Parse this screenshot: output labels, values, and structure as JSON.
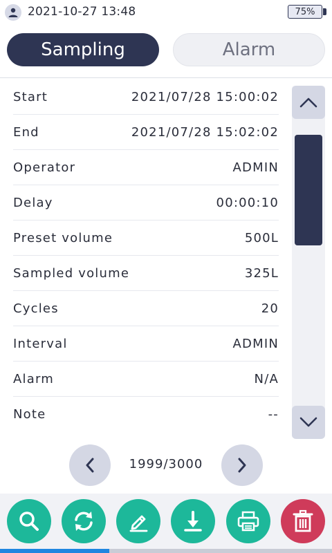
{
  "status": {
    "datetime": "2021-10-27 13:48",
    "battery": "75%",
    "user_icon": "user-icon"
  },
  "tabs": [
    {
      "label": "Sampling",
      "active": true
    },
    {
      "label": "Alarm",
      "active": false
    }
  ],
  "record": [
    {
      "label": "Start",
      "value": "2021/07/28 15:00:02"
    },
    {
      "label": "End",
      "value": "2021/07/28 15:02:02"
    },
    {
      "label": "Operator",
      "value": "ADMIN"
    },
    {
      "label": "Delay",
      "value": "00:00:10"
    },
    {
      "label": "Preset volume",
      "value": "500L"
    },
    {
      "label": "Sampled volume",
      "value": "325L"
    },
    {
      "label": "Cycles",
      "value": "20"
    },
    {
      "label": "Interval",
      "value": "ADMIN"
    },
    {
      "label": "Alarm",
      "value": "N/A"
    },
    {
      "label": "Note",
      "value": "--"
    }
  ],
  "pager": {
    "text": "1999/3000",
    "prev_icon": "chevron-left-icon",
    "next_icon": "chevron-right-icon"
  },
  "toolbar": [
    {
      "icon": "search-icon"
    },
    {
      "icon": "refresh-icon"
    },
    {
      "icon": "edit-icon"
    },
    {
      "icon": "download-icon"
    },
    {
      "icon": "print-icon"
    },
    {
      "icon": "trash-icon"
    }
  ],
  "progress": 0.33,
  "colors": {
    "accent_dark": "#2e3553",
    "tool_green": "#1db89a",
    "delete_red": "#cf3b5a",
    "progress_blue": "#1f86e0"
  }
}
